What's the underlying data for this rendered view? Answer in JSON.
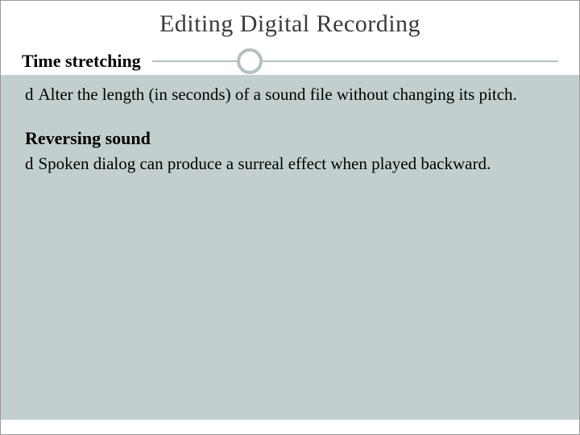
{
  "title": "Editing Digital Recording",
  "bullet_glyph": "d",
  "section1": {
    "heading": "Time stretching",
    "items": [
      "Alter the length (in seconds) of a sound file without changing its pitch."
    ]
  },
  "section2": {
    "heading": "Reversing sound",
    "items": [
      "Spoken dialog can produce a surreal effect when played backward."
    ]
  }
}
